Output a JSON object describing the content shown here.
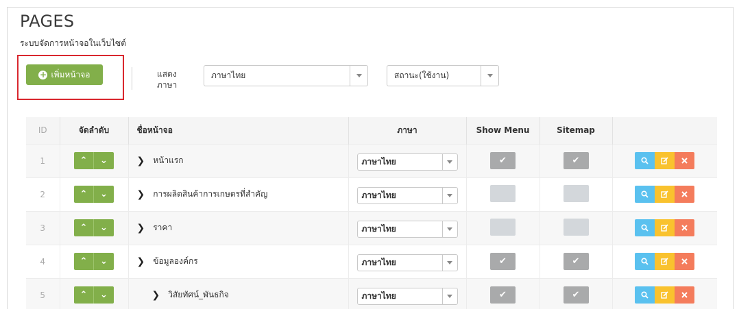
{
  "header": {
    "title": "PAGES",
    "subtitle": "ระบบจัดการหน้าจอในเว็บไซต์"
  },
  "toolbar": {
    "add_label": "เพิ่มหน้าจอ",
    "show_lang_label": "แสดงภาษา",
    "language_value": "ภาษาไทย",
    "status_value": "สถานะ(ใช้งาน)"
  },
  "table": {
    "columns": {
      "id": "ID",
      "order": "จัดลำดับ",
      "name": "ชื่อหน้าจอ",
      "language": "ภาษา",
      "show_menu": "Show Menu",
      "sitemap": "Sitemap"
    },
    "rows": [
      {
        "id": "1",
        "name": "หน้าแรก",
        "language": "ภาษาไทย",
        "show_menu": true,
        "sitemap": true,
        "level": 0
      },
      {
        "id": "2",
        "name": "การผลิตสินค้าการเกษตรที่สำคัญ",
        "language": "ภาษาไทย",
        "show_menu": false,
        "sitemap": false,
        "level": 0
      },
      {
        "id": "3",
        "name": "ราคา",
        "language": "ภาษาไทย",
        "show_menu": false,
        "sitemap": false,
        "level": 0
      },
      {
        "id": "4",
        "name": "ข้อมูลองค์กร",
        "language": "ภาษาไทย",
        "show_menu": true,
        "sitemap": true,
        "level": 0
      },
      {
        "id": "5",
        "name": "วิสัยทัศน์_พันธกิจ",
        "language": "ภาษาไทย",
        "show_menu": true,
        "sitemap": true,
        "level": 1
      }
    ]
  },
  "icons": {
    "add": "plus-circle-icon",
    "up": "chevron-up-icon",
    "down": "chevron-down-icon",
    "expand": "chevron-right-icon",
    "check": "check-icon",
    "view": "search-icon",
    "edit": "edit-icon",
    "delete": "close-icon"
  },
  "colors": {
    "green": "#82af4a",
    "view": "#5ac1ef",
    "edit": "#f9c22e",
    "delete": "#f47c5c",
    "highlight": "#d9272e"
  }
}
